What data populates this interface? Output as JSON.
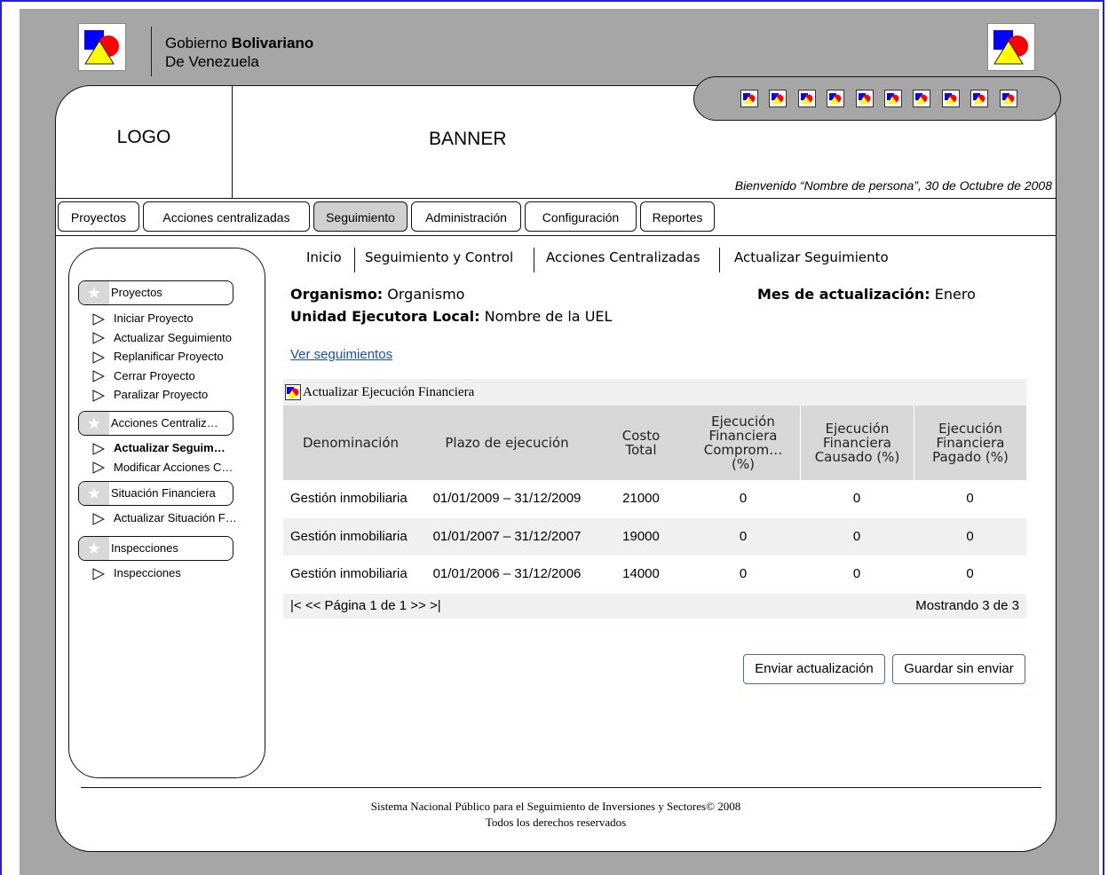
{
  "government": {
    "line1_prefix": "Gobierno ",
    "line1_bold": "Bolivariano",
    "line2": "De Venezuela"
  },
  "header": {
    "logo_label": "LOGO",
    "banner_label": "BANNER",
    "welcome": "Bienvenido “Nombre de persona”, 30 de Octubre de 2008",
    "icon_count": 10
  },
  "tabs": [
    {
      "label": "Proyectos",
      "active": false
    },
    {
      "label": "Acciones centralizadas",
      "active": false
    },
    {
      "label": "Seguimiento",
      "active": true
    },
    {
      "label": "Administración",
      "active": false
    },
    {
      "label": "Configuración",
      "active": false
    },
    {
      "label": "Reportes",
      "active": false
    }
  ],
  "sidebar": {
    "sections": [
      {
        "label": "Proyectos",
        "items": [
          "Iniciar Proyecto",
          "Actualizar Seguimiento",
          "Replanificar Proyecto",
          "Cerrar Proyecto",
          "Paralizar Proyecto"
        ]
      },
      {
        "label": "Acciones Centraliz…",
        "items": [
          "Actualizar Seguim…",
          "Modificar Acciones C…"
        ]
      },
      {
        "label": "Situación Financiera",
        "items": [
          "Actualizar Situación F…"
        ]
      },
      {
        "label": "Inspecciones",
        "items": [
          "Inspecciones"
        ]
      }
    ]
  },
  "breadcrumb": [
    "Inicio",
    "Seguimiento y Control",
    "Acciones Centralizadas",
    "Actualizar Seguimiento"
  ],
  "info": {
    "organismo_label": "Organismo:",
    "organismo_value": " Organismo",
    "mes_label": "Mes de actualización:",
    "mes_value": " Enero",
    "uel_label": "Unidad Ejecutora Local:",
    "uel_value": " Nombre de la UEL"
  },
  "link_ver": "Ver seguimientos",
  "panel_title": "Actualizar Ejecución Financiera",
  "table": {
    "headers": [
      "Denominación",
      "Plazo de ejecución",
      "Costo Total",
      "Ejecución Financiera Comprom… (%)",
      "Ejecución Financiera Causado (%)",
      "Ejecución Financiera Pagado (%)"
    ],
    "rows": [
      [
        "Gestión inmobiliaria",
        "01/01/2009 – 31/12/2009",
        "21000",
        "0",
        "0",
        "0"
      ],
      [
        "Gestión inmobiliaria",
        "01/01/2007 – 31/12/2007",
        "19000",
        "0",
        "0",
        "0"
      ],
      [
        "Gestión inmobiliaria",
        "01/01/2006 – 31/12/2006",
        "14000",
        "0",
        "0",
        "0"
      ]
    ]
  },
  "pager": {
    "nav": "|<  << Página 1 de 1 >>  >|",
    "showing": "Mostrando 3 de 3"
  },
  "buttons": {
    "send": "Enviar actualización",
    "save": "Guardar sin enviar"
  },
  "footer": {
    "line1": "Sistema Nacional Público para el Seguimiento de Inversiones y Sectores© 2008",
    "line2": "Todos los derechos reservados"
  },
  "colors": {
    "accent_link": "#1a4fa8",
    "frame_border": "#2222cc",
    "background_gray": "#a6a6a6"
  }
}
